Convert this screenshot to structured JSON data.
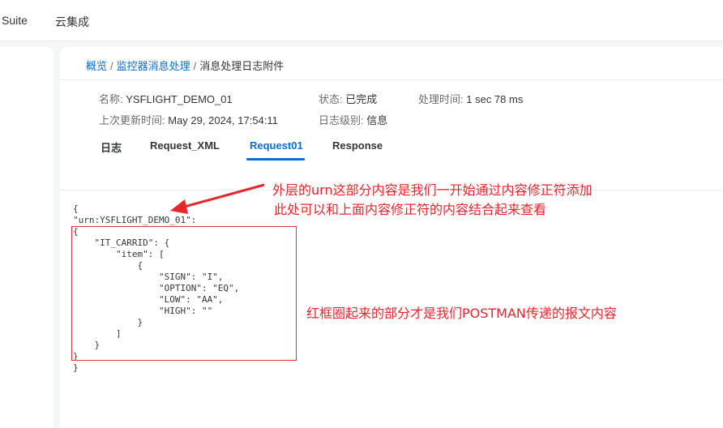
{
  "topnav": {
    "suite_label": "Suite",
    "cloud_label": "云集成"
  },
  "breadcrumb": {
    "items": [
      "概览",
      "监控器消息处理",
      "消息处理日志附件"
    ],
    "separator": "/"
  },
  "details": {
    "name_label": "名称:",
    "name_value": "YSFLIGHT_DEMO_01",
    "status_label": "状态:",
    "status_value": "已完成",
    "time_label": "处理时间:",
    "time_value": "1 sec 78 ms",
    "updated_label": "上次更新时间:",
    "updated_value": "May 29, 2024, 17:54:11",
    "loglevel_label": "日志级别:",
    "loglevel_value": "信息"
  },
  "tabs": [
    {
      "label": "日志",
      "active": false
    },
    {
      "label": "Request_XML",
      "active": false
    },
    {
      "label": "Request01",
      "active": true
    },
    {
      "label": "Response",
      "active": false
    }
  ],
  "payload": "{\n\"urn:YSFLIGHT_DEMO_01\":\n{\n    \"IT_CARRID\": {\n        \"item\": [\n            {\n                \"SIGN\": \"I\",\n                \"OPTION\": \"EQ\",\n                \"LOW\": \"AA\",\n                \"HIGH\": \"\"\n            }\n        ]\n    }\n}\n}",
  "annotations": {
    "note1_line1": "外层的urn这部分内容是我们一开始通过内容修正符添加",
    "note1_line2": "此处可以和上面内容修正符的内容结合起来查看",
    "note2": "红框圈起来的部分才是我们POSTMAN传递的报文内容",
    "color": "#e8262c"
  },
  "colors": {
    "accent": "#0a6ed1",
    "annotation_red": "#e8262c",
    "page_bg": "#f5f6f7"
  }
}
